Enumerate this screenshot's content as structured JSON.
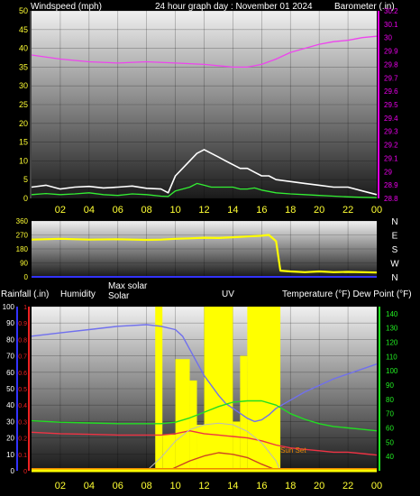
{
  "header": {
    "wind_axis_title": "Windspeed (mph)",
    "graph_day": "24 hour graph day : November 01 2024",
    "barometer_axis_title": "Barometer (.in)"
  },
  "mid_labels": {
    "rainfall": "Rainfall (.in)",
    "humidity": "Humidity",
    "max_solar": "Max solar",
    "solar": "Solar",
    "uv": "UV",
    "temperature_dewpoint": "Temperature (°F) Dew Point (°F)"
  },
  "sun_set_label": "Sun Set",
  "hour_ticks": [
    "02",
    "04",
    "06",
    "08",
    "10",
    "12",
    "14",
    "16",
    "18",
    "20",
    "22",
    "00"
  ],
  "colors": {
    "windspeed": "#ffffff",
    "wind_avg": "#33ee33",
    "barometer": "#ee44ee",
    "direction": "#ffff00",
    "humidity": "#7070ee",
    "temperature": "#ee3344",
    "dewpoint": "#22dd22",
    "rain": "#ee8800",
    "solar": "#ffff00",
    "max_solar": "#bbbbbb",
    "uv": "#cc4422",
    "axis_yellow": "#ffff33",
    "axis_magenta": "#ee00ee",
    "axis_green": "#22ee22",
    "axis_red": "#ee2222",
    "axis_blue": "#3333ff"
  },
  "chart_data": [
    {
      "id": "wind_baro",
      "type": "line",
      "x_label": "hour",
      "xlim": [
        0,
        24
      ],
      "y_left": {
        "title": "Windspeed (mph)",
        "ylim": [
          0,
          50
        ],
        "ticks": [
          0,
          5,
          10,
          15,
          20,
          25,
          30,
          35,
          40,
          45,
          50
        ]
      },
      "y_right": {
        "title": "Barometer (.in)",
        "ylim": [
          28.8,
          30.2
        ],
        "ticks": [
          "28.8",
          "28.9",
          "29",
          "29.1",
          "29.2",
          "29.3",
          "29.4",
          "29.5",
          "29.6",
          "29.7",
          "29.8",
          "29.9",
          "30",
          "30.1",
          "30.2"
        ]
      },
      "series": [
        {
          "key": "windspeed",
          "axis": "left",
          "points": [
            [
              0,
              3
            ],
            [
              1,
              3.5
            ],
            [
              2,
              2.5
            ],
            [
              3,
              3
            ],
            [
              4,
              3.2
            ],
            [
              5,
              2.8
            ],
            [
              6,
              3
            ],
            [
              7,
              3.3
            ],
            [
              8,
              2.7
            ],
            [
              9,
              2.5
            ],
            [
              9.5,
              1.5
            ],
            [
              10,
              6
            ],
            [
              10.5,
              8
            ],
            [
              11,
              10
            ],
            [
              11.5,
              12
            ],
            [
              12,
              13
            ],
            [
              12.5,
              12
            ],
            [
              13,
              11
            ],
            [
              13.5,
              10
            ],
            [
              14,
              9
            ],
            [
              14.5,
              8
            ],
            [
              15,
              8
            ],
            [
              15.5,
              7
            ],
            [
              16,
              6
            ],
            [
              16.5,
              6
            ],
            [
              17,
              5
            ],
            [
              18,
              4.5
            ],
            [
              19,
              4
            ],
            [
              20,
              3.5
            ],
            [
              21,
              3
            ],
            [
              22,
              3
            ],
            [
              23,
              2
            ],
            [
              24,
              1
            ]
          ]
        },
        {
          "key": "wind_avg",
          "axis": "left",
          "points": [
            [
              0,
              1
            ],
            [
              1,
              1.3
            ],
            [
              2,
              1
            ],
            [
              3,
              1.2
            ],
            [
              4,
              1.5
            ],
            [
              5,
              1
            ],
            [
              6,
              0.8
            ],
            [
              7,
              1.2
            ],
            [
              8,
              1
            ],
            [
              9,
              0.6
            ],
            [
              9.5,
              0.5
            ],
            [
              10,
              2
            ],
            [
              10.5,
              2.5
            ],
            [
              11,
              3
            ],
            [
              11.5,
              4
            ],
            [
              12,
              3.5
            ],
            [
              12.5,
              3
            ],
            [
              13,
              3
            ],
            [
              13.5,
              3
            ],
            [
              14,
              3
            ],
            [
              14.5,
              2.5
            ],
            [
              15,
              2.5
            ],
            [
              15.5,
              2.8
            ],
            [
              16,
              2.2
            ],
            [
              17,
              1.5
            ],
            [
              18,
              1.2
            ],
            [
              19,
              1
            ],
            [
              20,
              0.8
            ],
            [
              21,
              0.6
            ],
            [
              22,
              0.4
            ],
            [
              23,
              0.3
            ],
            [
              24,
              0.2
            ]
          ]
        },
        {
          "key": "barometer",
          "axis": "right",
          "points": [
            [
              0,
              29.87
            ],
            [
              2,
              29.84
            ],
            [
              4,
              29.82
            ],
            [
              6,
              29.81
            ],
            [
              8,
              29.82
            ],
            [
              10,
              29.81
            ],
            [
              12,
              29.8
            ],
            [
              14,
              29.78
            ],
            [
              15,
              29.78
            ],
            [
              16,
              29.8
            ],
            [
              17,
              29.84
            ],
            [
              18,
              29.89
            ],
            [
              19,
              29.92
            ],
            [
              20,
              29.95
            ],
            [
              21,
              29.97
            ],
            [
              22,
              29.98
            ],
            [
              23,
              30.0
            ],
            [
              24,
              30.01
            ]
          ]
        }
      ]
    },
    {
      "id": "wind_direction",
      "type": "line",
      "xlim": [
        0,
        24
      ],
      "y_left": {
        "ylim": [
          0,
          360
        ],
        "ticks": [
          0,
          90,
          180,
          270,
          360
        ]
      },
      "y_right": {
        "ticks": [
          "N",
          "W",
          "S",
          "E",
          "N"
        ]
      },
      "series": [
        {
          "key": "direction",
          "axis": "left",
          "points": [
            [
              0,
              240
            ],
            [
              2,
              245
            ],
            [
              4,
              240
            ],
            [
              6,
              242
            ],
            [
              8,
              238
            ],
            [
              9,
              240
            ],
            [
              10,
              245
            ],
            [
              11,
              248
            ],
            [
              12,
              252
            ],
            [
              13,
              250
            ],
            [
              14,
              255
            ],
            [
              15,
              260
            ],
            [
              16,
              265
            ],
            [
              16.5,
              270
            ],
            [
              17,
              230
            ],
            [
              17.3,
              40
            ],
            [
              18,
              35
            ],
            [
              19,
              30
            ],
            [
              20,
              35
            ],
            [
              21,
              30
            ],
            [
              22,
              32
            ],
            [
              23,
              30
            ],
            [
              24,
              28
            ]
          ]
        }
      ]
    },
    {
      "id": "rain_temp_solar",
      "type": "line",
      "xlim": [
        0,
        24
      ],
      "y_rain": {
        "title": "Rainfall (.in)",
        "ylim": [
          0,
          1
        ],
        "ticks": [
          "0",
          "0.1",
          "0.2",
          "0.3",
          "0.4",
          "0.5",
          "0.6",
          "0.7",
          "0.8",
          "0.9",
          "1"
        ]
      },
      "y_humidity": {
        "title": "Humidity",
        "ylim": [
          0,
          100
        ],
        "ticks": [
          0,
          10,
          20,
          30,
          40,
          50,
          60,
          70,
          80,
          90,
          100
        ]
      },
      "y_temp": {
        "title": "Temperature (°F) Dew Point (°F)",
        "ylim": [
          30,
          145
        ],
        "ticks": [
          40,
          50,
          60,
          70,
          80,
          90,
          100,
          110,
          120,
          130,
          140
        ]
      },
      "series": [
        {
          "key": "humidity",
          "axis": "humidity",
          "points": [
            [
              0,
              82
            ],
            [
              2,
              84
            ],
            [
              4,
              86
            ],
            [
              6,
              88
            ],
            [
              8,
              89
            ],
            [
              9,
              88
            ],
            [
              10,
              86
            ],
            [
              10.5,
              82
            ],
            [
              11,
              74
            ],
            [
              11.5,
              66
            ],
            [
              12,
              58
            ],
            [
              12.5,
              52
            ],
            [
              13,
              46
            ],
            [
              13.5,
              41
            ],
            [
              14,
              38
            ],
            [
              14.5,
              35
            ],
            [
              15,
              32
            ],
            [
              15.5,
              30
            ],
            [
              16,
              31
            ],
            [
              16.5,
              34
            ],
            [
              17,
              38
            ],
            [
              18,
              43
            ],
            [
              19,
              48
            ],
            [
              20,
              52
            ],
            [
              21,
              56
            ],
            [
              22,
              59
            ],
            [
              23,
              62
            ],
            [
              24,
              65
            ]
          ]
        },
        {
          "key": "temperature",
          "axis": "temp",
          "points": [
            [
              0,
              57
            ],
            [
              2,
              56
            ],
            [
              4,
              55.5
            ],
            [
              6,
              55
            ],
            [
              8,
              55
            ],
            [
              9,
              55
            ],
            [
              10,
              56
            ],
            [
              11,
              58
            ],
            [
              11.5,
              57
            ],
            [
              12,
              56
            ],
            [
              13,
              55
            ],
            [
              14,
              54
            ],
            [
              15,
              53
            ],
            [
              16,
              51
            ],
            [
              17,
              48
            ],
            [
              18,
              46
            ],
            [
              19,
              45
            ],
            [
              20,
              44
            ],
            [
              21,
              43
            ],
            [
              22,
              43
            ],
            [
              23,
              42
            ],
            [
              24,
              41
            ]
          ]
        },
        {
          "key": "dewpoint",
          "axis": "temp",
          "points": [
            [
              0,
              65
            ],
            [
              2,
              64
            ],
            [
              4,
              63.5
            ],
            [
              6,
              63
            ],
            [
              8,
              63
            ],
            [
              9,
              63
            ],
            [
              10,
              64
            ],
            [
              11,
              67
            ],
            [
              12,
              71
            ],
            [
              13,
              75
            ],
            [
              14,
              78
            ],
            [
              15,
              79
            ],
            [
              16,
              79
            ],
            [
              17,
              76
            ],
            [
              18,
              70
            ],
            [
              19,
              66
            ],
            [
              20,
              63
            ],
            [
              21,
              61
            ],
            [
              22,
              60
            ],
            [
              23,
              59
            ],
            [
              24,
              58
            ]
          ]
        },
        {
          "key": "max_solar",
          "axis": "humidity",
          "points": [
            [
              8,
              0
            ],
            [
              9,
              8
            ],
            [
              10,
              18
            ],
            [
              11,
              25
            ],
            [
              12,
              28
            ],
            [
              13,
              29
            ],
            [
              14,
              28
            ],
            [
              15,
              24
            ],
            [
              16,
              17
            ],
            [
              17,
              6
            ],
            [
              17.3,
              0
            ]
          ]
        },
        {
          "key": "uv",
          "axis": "humidity",
          "points": [
            [
              9.5,
              0
            ],
            [
              10,
              2
            ],
            [
              11,
              6
            ],
            [
              12,
              9
            ],
            [
              13,
              11
            ],
            [
              14,
              10
            ],
            [
              15,
              8
            ],
            [
              16,
              4
            ],
            [
              17,
              0.5
            ],
            [
              17.2,
              0
            ]
          ]
        },
        {
          "key": "rain",
          "axis": "rain",
          "points": [
            [
              0,
              0.01
            ],
            [
              24,
              0.01
            ]
          ]
        }
      ],
      "solar_bands": [
        {
          "start": 8.6,
          "end": 9.1,
          "value": 100
        },
        {
          "start": 9.1,
          "end": 10.0,
          "value": 22
        },
        {
          "start": 10.0,
          "end": 11.0,
          "value": 68
        },
        {
          "start": 11.0,
          "end": 11.5,
          "value": 55
        },
        {
          "start": 11.5,
          "end": 12.0,
          "value": 28
        },
        {
          "start": 12.0,
          "end": 14.0,
          "value": 100
        },
        {
          "start": 14.0,
          "end": 14.5,
          "value": 30
        },
        {
          "start": 14.5,
          "end": 15.0,
          "value": 70
        },
        {
          "start": 15.0,
          "end": 17.3,
          "value": 100
        }
      ],
      "annotations": [
        "Sun Set"
      ]
    }
  ]
}
